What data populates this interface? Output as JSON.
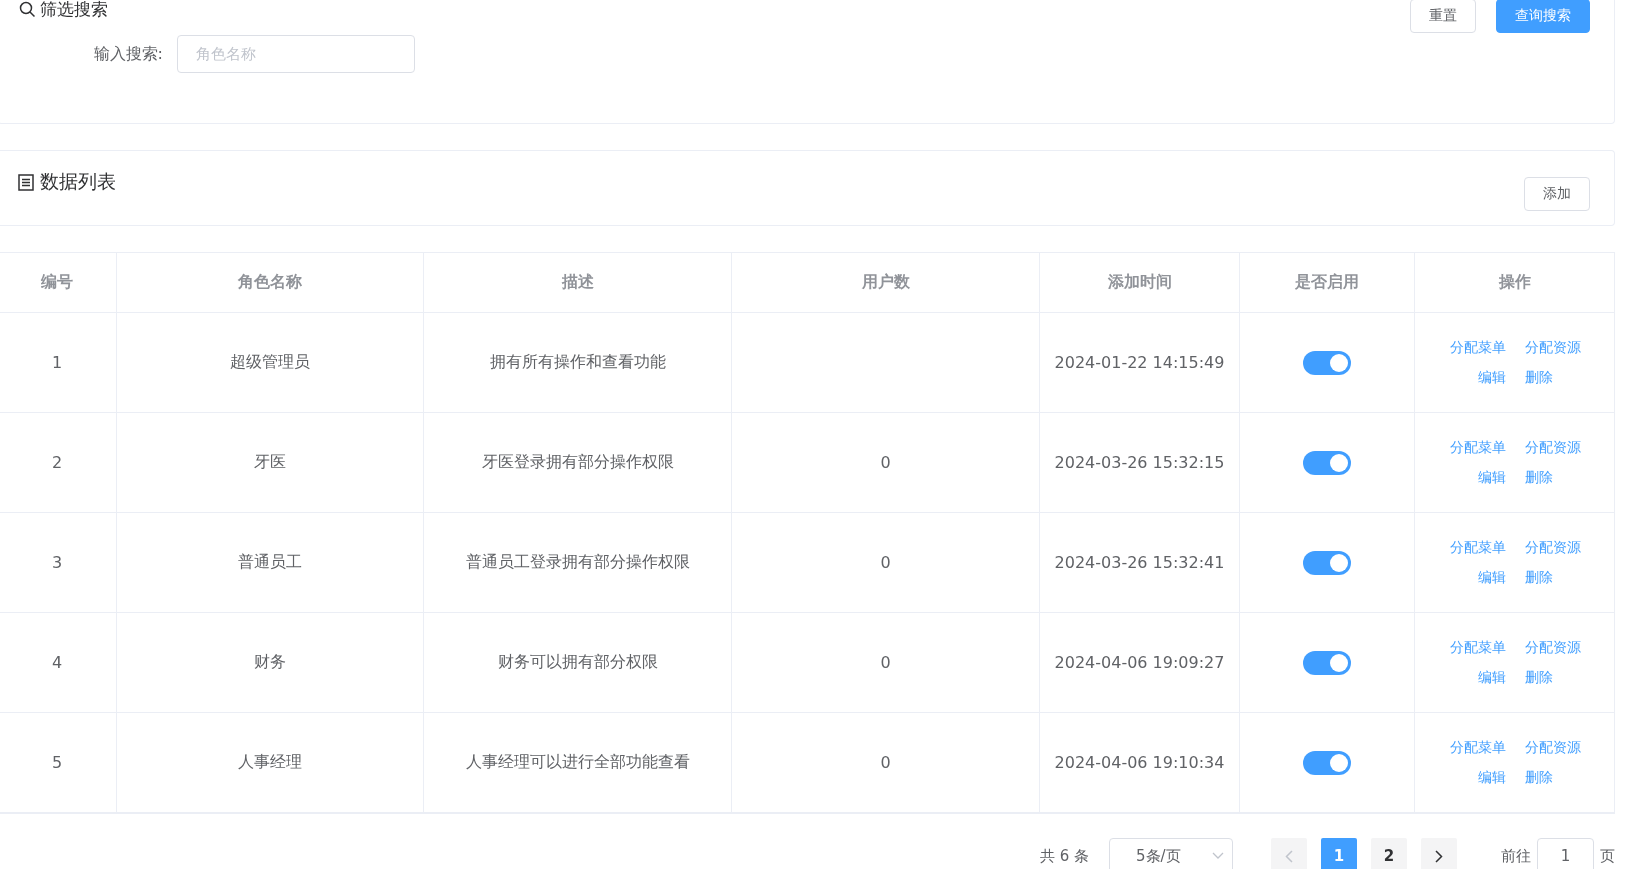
{
  "filter": {
    "title": "筛选搜索",
    "label": "输入搜索:",
    "placeholder": "角色名称",
    "buttons": [
      {
        "label": "重置",
        "kind": "plain"
      },
      {
        "label": "查询搜索",
        "kind": "primary"
      }
    ]
  },
  "list_header": {
    "title": "数据列表",
    "button": "添加"
  },
  "table": {
    "columns": [
      "编号",
      "角色名称",
      "描述",
      "用户数",
      "添加时间",
      "是否启用",
      "操作"
    ],
    "rows": [
      {
        "id": "1",
        "name": "超级管理员",
        "description": "拥有所有操作和查看功能",
        "users": "",
        "time": "2024-01-22 14:15:49",
        "enabled": true,
        "actions": [
          "分配菜单",
          "分配资源",
          "编辑",
          "删除"
        ]
      },
      {
        "id": "2",
        "name": "牙医",
        "description": "牙医登录拥有部分操作权限",
        "users": "0",
        "time": "2024-03-26 15:32:15",
        "enabled": true,
        "actions": [
          "分配菜单",
          "分配资源",
          "编辑",
          "删除"
        ]
      },
      {
        "id": "3",
        "name": "普通员工",
        "description": "普通员工登录拥有部分操作权限",
        "users": "0",
        "time": "2024-03-26 15:32:41",
        "enabled": true,
        "actions": [
          "分配菜单",
          "分配资源",
          "编辑",
          "删除"
        ]
      },
      {
        "id": "4",
        "name": "财务",
        "description": "财务可以拥有部分权限",
        "users": "0",
        "time": "2024-04-06 19:09:27",
        "enabled": true,
        "actions": [
          "分配菜单",
          "分配资源",
          "编辑",
          "删除"
        ]
      },
      {
        "id": "5",
        "name": "人事经理",
        "description": "人事经理可以进行全部功能查看",
        "users": "0",
        "time": "2024-04-06 19:10:34",
        "enabled": true,
        "actions": [
          "分配菜单",
          "分配资源",
          "编辑",
          "删除"
        ]
      }
    ]
  },
  "pagination": {
    "total": "共 6 条",
    "page_size": "5条/页",
    "pages": [
      {
        "label": "1",
        "selected": true
      },
      {
        "label": "2",
        "selected": false
      }
    ],
    "goto_label": "前往",
    "goto_value": "1",
    "goto_suffix": "页"
  }
}
